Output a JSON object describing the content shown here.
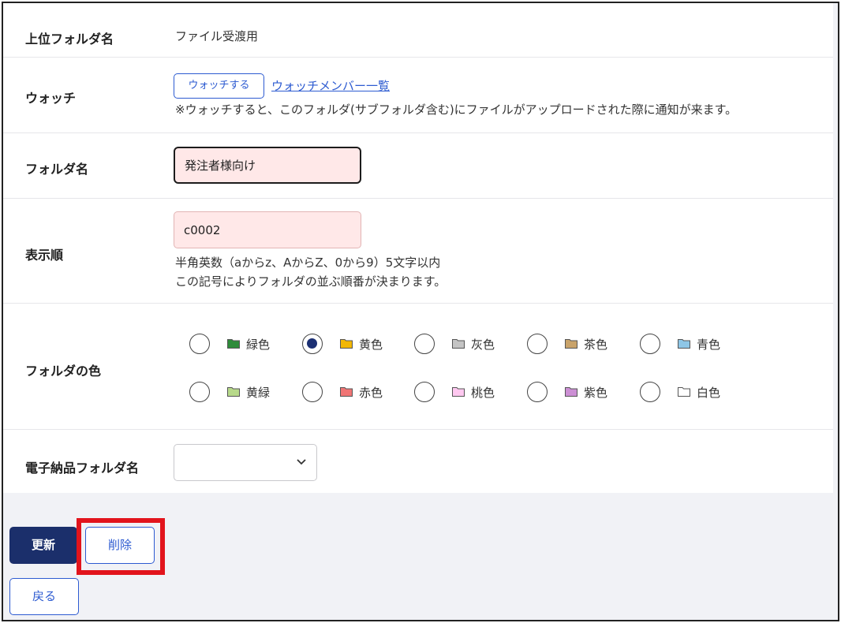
{
  "parent_folder": {
    "label": "上位フォルダ名",
    "value": "ファイル受渡用"
  },
  "watch": {
    "label": "ウォッチ",
    "button_label": "ウォッチする",
    "members_link": "ウォッチメンバー一覧",
    "note": "※ウォッチすると、このフォルダ(サブフォルダ含む)にファイルがアップロードされた際に通知が来ます。"
  },
  "folder_name": {
    "label": "フォルダ名",
    "value": "発注者様向け"
  },
  "display_order": {
    "label": "表示順",
    "value": "c0002",
    "hint1": "半角英数（aからz、AからZ、0から9）5文字以内",
    "hint2": "この記号によりフォルダの並ぶ順番が決まります。"
  },
  "folder_color": {
    "label": "フォルダの色",
    "selected": "黄色",
    "options": [
      {
        "name": "緑色",
        "color": "#2e8b3a"
      },
      {
        "name": "黄色",
        "color": "#f2b705"
      },
      {
        "name": "灰色",
        "color": "#c4c4c4"
      },
      {
        "name": "茶色",
        "color": "#c9a36a"
      },
      {
        "name": "青色",
        "color": "#8ec6e6"
      },
      {
        "name": "黄緑",
        "color": "#b7d98a"
      },
      {
        "name": "赤色",
        "color": "#f07575"
      },
      {
        "name": "桃色",
        "color": "#ffc8f0"
      },
      {
        "name": "紫色",
        "color": "#cc8fd4"
      },
      {
        "name": "白色",
        "color": "#ffffff"
      }
    ]
  },
  "delivery_folder": {
    "label": "電子納品フォルダ名",
    "selected": ""
  },
  "actions": {
    "update": "更新",
    "delete": "削除",
    "back": "戻る"
  }
}
